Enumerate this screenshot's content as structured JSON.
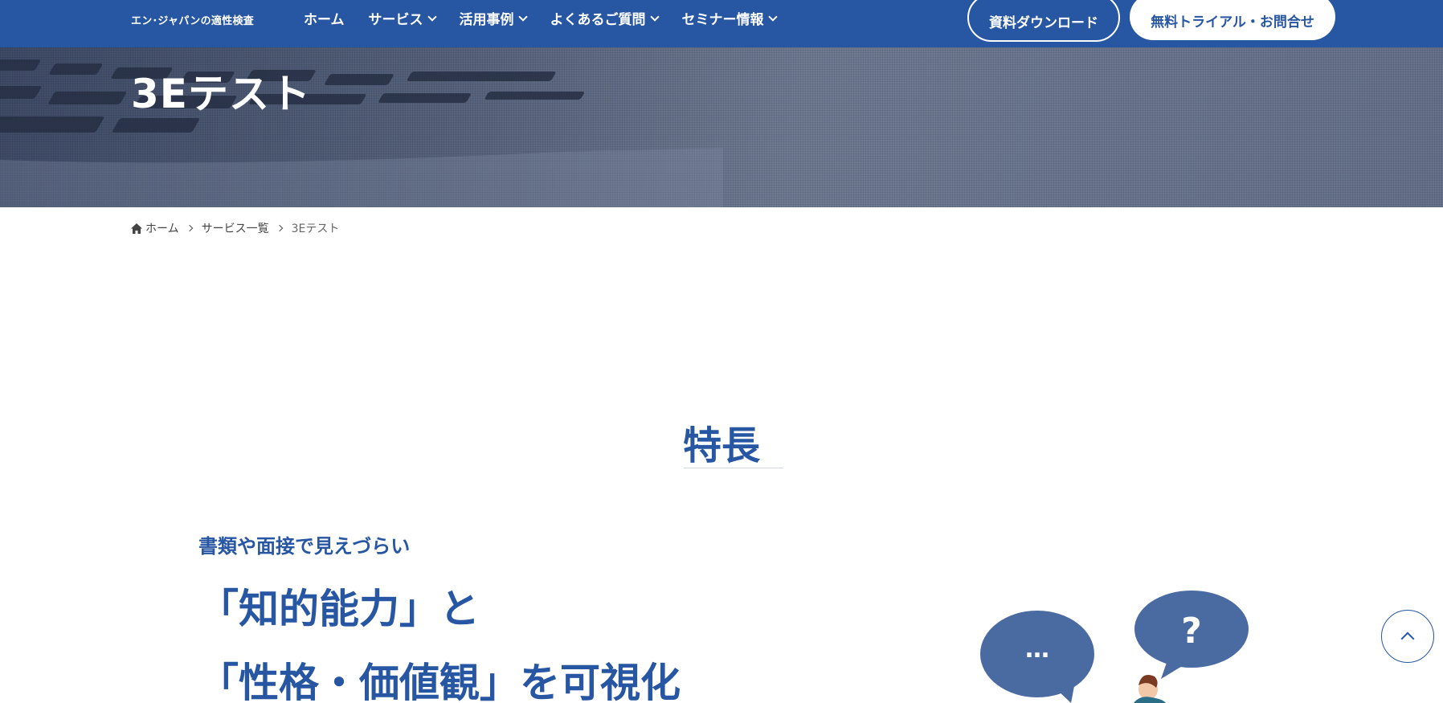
{
  "header": {
    "logo_text": "エン･ジャパンの適性検査",
    "nav": [
      {
        "label": "ホーム",
        "has_dropdown": false
      },
      {
        "label": "サービス",
        "has_dropdown": true
      },
      {
        "label": "活用事例",
        "has_dropdown": true
      },
      {
        "label": "よくあるご質問",
        "has_dropdown": true
      },
      {
        "label": "セミナー情報",
        "has_dropdown": true
      }
    ],
    "download_button": "資料ダウンロード",
    "trial_button": "無料トライアル・お問合せ",
    "brand_color": "#2756a2"
  },
  "hero": {
    "title": "3Eテスト"
  },
  "breadcrumb": {
    "home": "ホーム",
    "parent": "サービス一覧",
    "current": "3Eテスト"
  },
  "features": {
    "section_title": "特長",
    "sub_heading": "書類や面接で見えづらい",
    "heading_line1": "「知的能力」と",
    "heading_line2": "「性格・価値観」を可視化"
  },
  "illustration": {
    "bubble_left": "…",
    "bubble_right": "?"
  },
  "icons": {
    "home": "home-icon",
    "back_to_top": "chevron-up-icon"
  }
}
